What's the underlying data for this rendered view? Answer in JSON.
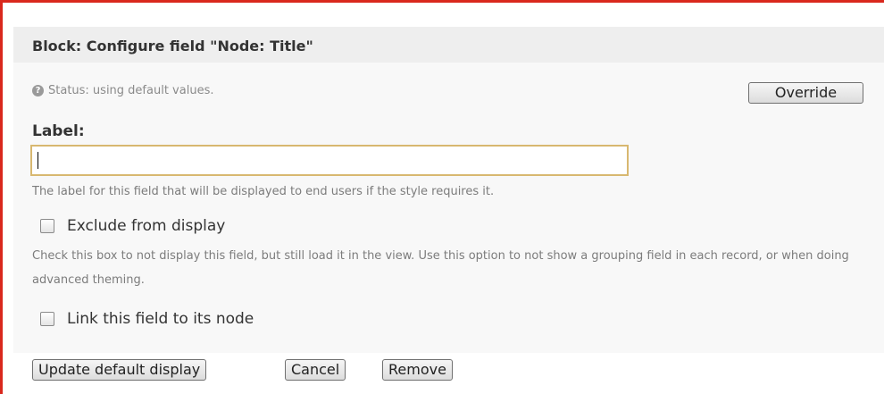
{
  "dialog": {
    "title": "Block: Configure field \"Node: Title\""
  },
  "status": {
    "icon": "help-icon",
    "icon_glyph": "?",
    "text": "Status: using default values.",
    "override_label": "Override"
  },
  "label_field": {
    "heading": "Label:",
    "value": "",
    "description": "The label for this field that will be displayed to end users if the style requires it."
  },
  "exclude": {
    "label": "Exclude from display",
    "checked": false,
    "description": "Check this box to not display this field, but still load it in the view. Use this option to not show a grouping field in each record, or when doing advanced theming."
  },
  "link_node": {
    "label": "Link this field to its node",
    "checked": false
  },
  "actions": {
    "update_label": "Update default display",
    "cancel_label": "Cancel",
    "remove_label": "Remove"
  },
  "colors": {
    "frame_border": "#d9281d",
    "input_focus_border": "#d8b870",
    "title_background": "#eeeeee",
    "panel_background": "#f8f8f8"
  }
}
